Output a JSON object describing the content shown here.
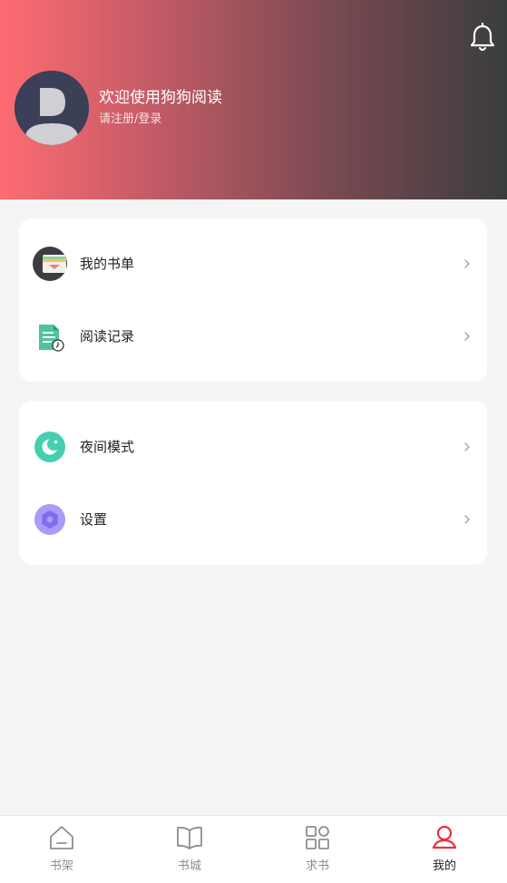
{
  "header": {
    "welcome_text": "欢迎使用狗狗阅读",
    "login_text": "请注册/登录",
    "notification_icon": "bell-icon",
    "avatar_icon": "default-avatar-icon"
  },
  "menu_groups": [
    {
      "items": [
        {
          "label": "我的书单",
          "icon": "wallet-icon"
        },
        {
          "label": "阅读记录",
          "icon": "document-clock-icon"
        }
      ]
    },
    {
      "items": [
        {
          "label": "夜间模式",
          "icon": "moon-mode-icon"
        },
        {
          "label": "设置",
          "icon": "settings-gear-icon"
        }
      ]
    }
  ],
  "tabbar": {
    "active_color": "#e8313a",
    "inactive_color": "#8e8e8e",
    "tabs": [
      {
        "label": "书架",
        "icon": "bookshelf-icon",
        "active": false
      },
      {
        "label": "书城",
        "icon": "open-book-icon",
        "active": false
      },
      {
        "label": "求书",
        "icon": "grid-icon",
        "active": false
      },
      {
        "label": "我的",
        "icon": "user-icon",
        "active": true
      }
    ]
  }
}
